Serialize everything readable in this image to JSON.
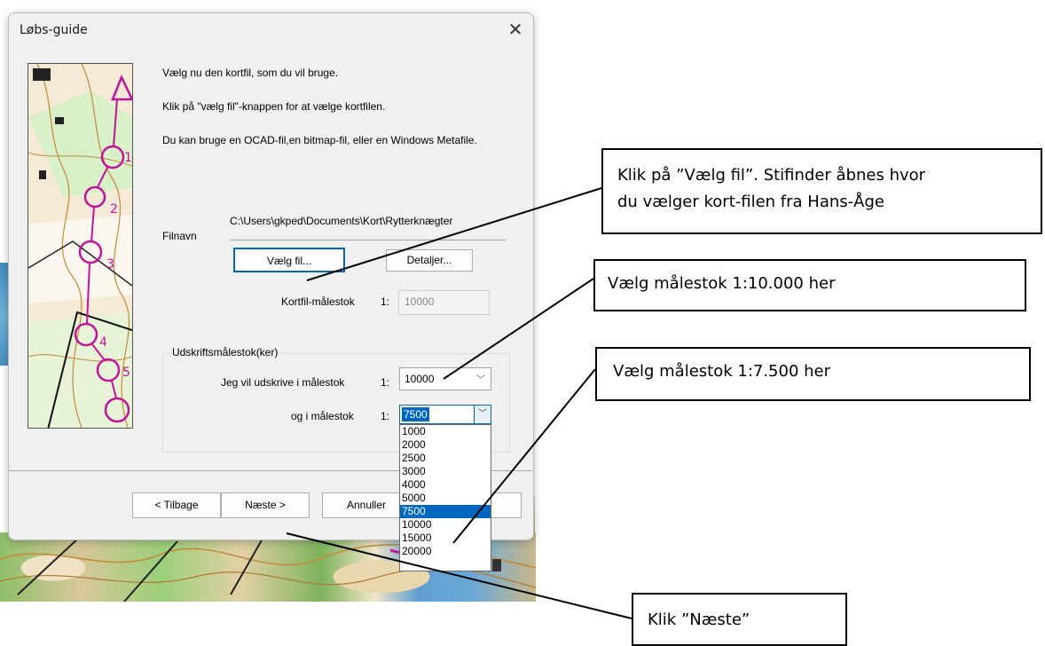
{
  "dialog": {
    "title": "Løbs-guide",
    "close_glyph": "✕",
    "intro_lines": [
      "Vælg nu den kortfil, som du vil bruge.",
      "Klik på \"vælg fil\"-knappen for at vælge kortfilen.",
      "Du kan bruge en OCAD-fil,en bitmap-fil, eller en Windows Metafile."
    ],
    "filename_label": "Filnavn",
    "filename_value": "C:\\Users\\gkped\\Documents\\Kort\\Rytterknægter",
    "choose_file_label": "Vælg fil...",
    "details_label": "Detaljer...",
    "map_scale_label": "Kortfil-målestok",
    "scale_prefix": "1:",
    "map_scale_value": "10000",
    "print_group_label": "Udskriftsmålestok(ker)",
    "print_scale1_label": "Jeg vil udskrive i målestok",
    "print_scale1_value": "10000",
    "print_scale2_label": "og i målestok",
    "print_scale2_value": "7500",
    "dropdown_options": [
      "1000",
      "2000",
      "2500",
      "3000",
      "4000",
      "5000",
      "7500",
      "10000",
      "15000",
      "20000"
    ],
    "dropdown_selected": "7500",
    "back_label": "< Tilbage",
    "next_label": "Næste >",
    "cancel_label": "Annuller"
  },
  "callouts": {
    "choose_file": [
      "Klik på ”Vælg fil”. Stifinder åbnes hvor",
      "du vælger kort-filen fra Hans-Åge"
    ],
    "scale1": "Vælg målestok 1:10.000 her",
    "scale2": "Vælg målestok 1:7.500 her",
    "next": "Klik ”Næste”"
  },
  "colors": {
    "accent": "#0067c0",
    "dialog_bg": "#f0f0f0",
    "course_magenta": "#c0159a"
  }
}
